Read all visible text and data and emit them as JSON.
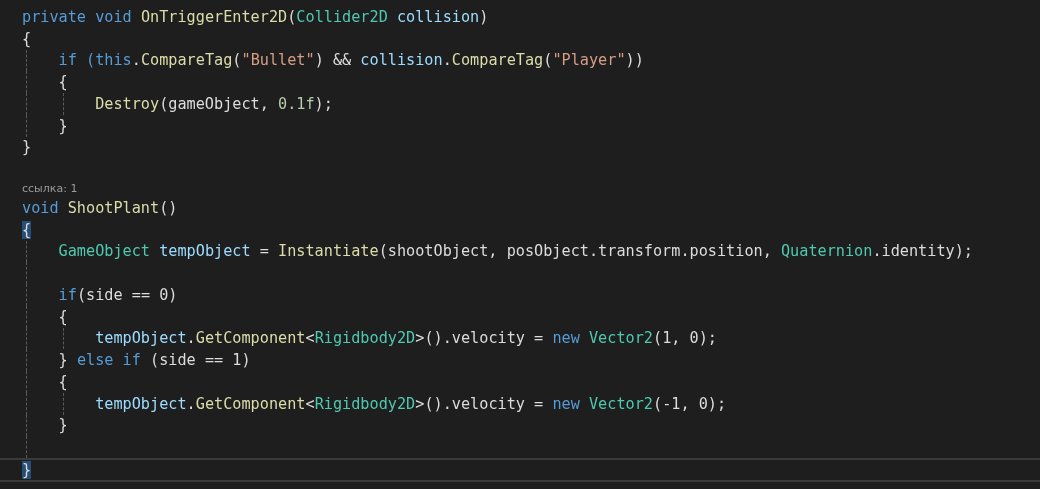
{
  "editor": {
    "lines": [
      {
        "kind": "code",
        "current": false,
        "tokens": [
          {
            "text": "private void ",
            "kind": "keyword"
          },
          {
            "text": "OnTriggerEnter2D",
            "kind": "method"
          },
          {
            "text": "(",
            "kind": "plain"
          },
          {
            "text": "Collider2D",
            "kind": "type"
          },
          {
            "text": " collision",
            "kind": "variable"
          },
          {
            "text": ")",
            "kind": "plain"
          }
        ]
      },
      {
        "kind": "code",
        "current": false,
        "tokens": [
          {
            "text": "{",
            "kind": "plain"
          }
        ]
      },
      {
        "kind": "code",
        "current": false,
        "tokens": [
          {
            "text": "    if (",
            "kind": "keyword"
          },
          {
            "text": "this",
            "kind": "keyword"
          },
          {
            "text": ".",
            "kind": "plain"
          },
          {
            "text": "CompareTag",
            "kind": "method"
          },
          {
            "text": "(",
            "kind": "plain"
          },
          {
            "text": "\"Bullet\"",
            "kind": "string"
          },
          {
            "text": ") && ",
            "kind": "plain"
          },
          {
            "text": "collision",
            "kind": "variable"
          },
          {
            "text": ".",
            "kind": "plain"
          },
          {
            "text": "CompareTag",
            "kind": "method"
          },
          {
            "text": "(",
            "kind": "plain"
          },
          {
            "text": "\"Player\"",
            "kind": "string"
          },
          {
            "text": "))",
            "kind": "plain"
          }
        ]
      },
      {
        "kind": "code",
        "current": false,
        "tokens": [
          {
            "text": "    {",
            "kind": "plain"
          }
        ]
      },
      {
        "kind": "code",
        "current": false,
        "tokens": [
          {
            "text": "        Destroy",
            "kind": "method"
          },
          {
            "text": "(gameObject, ",
            "kind": "plain"
          },
          {
            "text": "0.1f",
            "kind": "number"
          },
          {
            "text": ");",
            "kind": "plain"
          }
        ]
      },
      {
        "kind": "code",
        "current": false,
        "tokens": [
          {
            "text": "    }",
            "kind": "plain"
          }
        ]
      },
      {
        "kind": "code",
        "current": false,
        "tokens": [
          {
            "text": "}",
            "kind": "plain"
          }
        ]
      },
      {
        "kind": "blank",
        "current": false
      },
      {
        "kind": "codelens",
        "text": "ссылка: 1"
      },
      {
        "kind": "code",
        "current": false,
        "tokens": [
          {
            "text": "void ",
            "kind": "keyword"
          },
          {
            "text": "ShootPlant",
            "kind": "method"
          },
          {
            "text": "()",
            "kind": "plain"
          }
        ]
      },
      {
        "kind": "code",
        "current": false,
        "tokens": [
          {
            "text": "{",
            "kind": "match"
          }
        ]
      },
      {
        "kind": "code",
        "current": false,
        "tokens": [
          {
            "text": "    GameObject",
            "kind": "type"
          },
          {
            "text": " tempObject",
            "kind": "variable"
          },
          {
            "text": " = ",
            "kind": "plain"
          },
          {
            "text": "Instantiate",
            "kind": "method"
          },
          {
            "text": "(shootObject, posObject.transform.position, ",
            "kind": "plain"
          },
          {
            "text": "Quaternion",
            "kind": "type"
          },
          {
            "text": ".identity);",
            "kind": "plain"
          }
        ]
      },
      {
        "kind": "blank",
        "current": false
      },
      {
        "kind": "code",
        "current": false,
        "tokens": [
          {
            "text": "    if",
            "kind": "keyword"
          },
          {
            "text": "(side == 0)",
            "kind": "plain"
          }
        ]
      },
      {
        "kind": "code",
        "current": false,
        "tokens": [
          {
            "text": "    {",
            "kind": "plain"
          }
        ]
      },
      {
        "kind": "code",
        "current": false,
        "tokens": [
          {
            "text": "        tempObject",
            "kind": "variable"
          },
          {
            "text": ".",
            "kind": "plain"
          },
          {
            "text": "GetComponent",
            "kind": "method"
          },
          {
            "text": "<",
            "kind": "plain"
          },
          {
            "text": "Rigidbody2D",
            "kind": "type"
          },
          {
            "text": ">().velocity = ",
            "kind": "plain"
          },
          {
            "text": "new ",
            "kind": "keyword"
          },
          {
            "text": "Vector2",
            "kind": "type"
          },
          {
            "text": "(1, 0);",
            "kind": "plain"
          }
        ]
      },
      {
        "kind": "code",
        "current": false,
        "tokens": [
          {
            "text": "    } ",
            "kind": "plain"
          },
          {
            "text": "else if",
            "kind": "keyword"
          },
          {
            "text": " (side == 1)",
            "kind": "plain"
          }
        ]
      },
      {
        "kind": "code",
        "current": false,
        "tokens": [
          {
            "text": "    {",
            "kind": "plain"
          }
        ]
      },
      {
        "kind": "code",
        "current": false,
        "tokens": [
          {
            "text": "        tempObject",
            "kind": "variable"
          },
          {
            "text": ".",
            "kind": "plain"
          },
          {
            "text": "GetComponent",
            "kind": "method"
          },
          {
            "text": "<",
            "kind": "plain"
          },
          {
            "text": "Rigidbody2D",
            "kind": "type"
          },
          {
            "text": ">().velocity = ",
            "kind": "plain"
          },
          {
            "text": "new ",
            "kind": "keyword"
          },
          {
            "text": "Vector2",
            "kind": "type"
          },
          {
            "text": "(-1, 0);",
            "kind": "plain"
          }
        ]
      },
      {
        "kind": "code",
        "current": false,
        "tokens": [
          {
            "text": "    }",
            "kind": "plain"
          }
        ]
      },
      {
        "kind": "blank",
        "current": false
      },
      {
        "kind": "code",
        "current": true,
        "tokens": [
          {
            "text": "}",
            "kind": "match"
          }
        ]
      }
    ]
  }
}
